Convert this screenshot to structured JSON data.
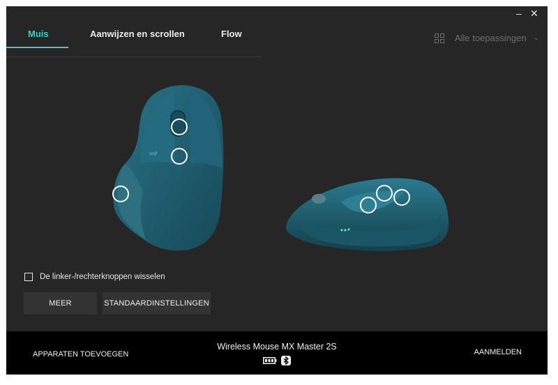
{
  "window": {
    "minimize_label": "–",
    "close_label": "✕"
  },
  "tabs": [
    {
      "label": "Muis",
      "active": true
    },
    {
      "label": "Aanwijzen en scrollen",
      "active": false
    },
    {
      "label": "Flow",
      "active": false
    }
  ],
  "app_selector": {
    "label": "Alle toepassingen",
    "icon": "grid-icon"
  },
  "mouse": {
    "brand_label": "logi",
    "color": "#1f5d6e"
  },
  "options": {
    "swap_buttons_label": "De linker-/rechterknoppen wisselen",
    "swap_buttons_checked": false
  },
  "buttons": {
    "more_label": "MEER",
    "defaults_label": "STANDAARDINSTELLINGEN"
  },
  "footer": {
    "add_devices_label": "APPARATEN TOEVOEGEN",
    "device_name": "Wireless Mouse MX Master 2S",
    "login_label": "AANMELDEN",
    "battery_icon": "battery-icon",
    "connection_icon": "bluetooth-icon"
  },
  "colors": {
    "accent": "#35d1c3",
    "background": "#262626",
    "footer": "#000000"
  }
}
